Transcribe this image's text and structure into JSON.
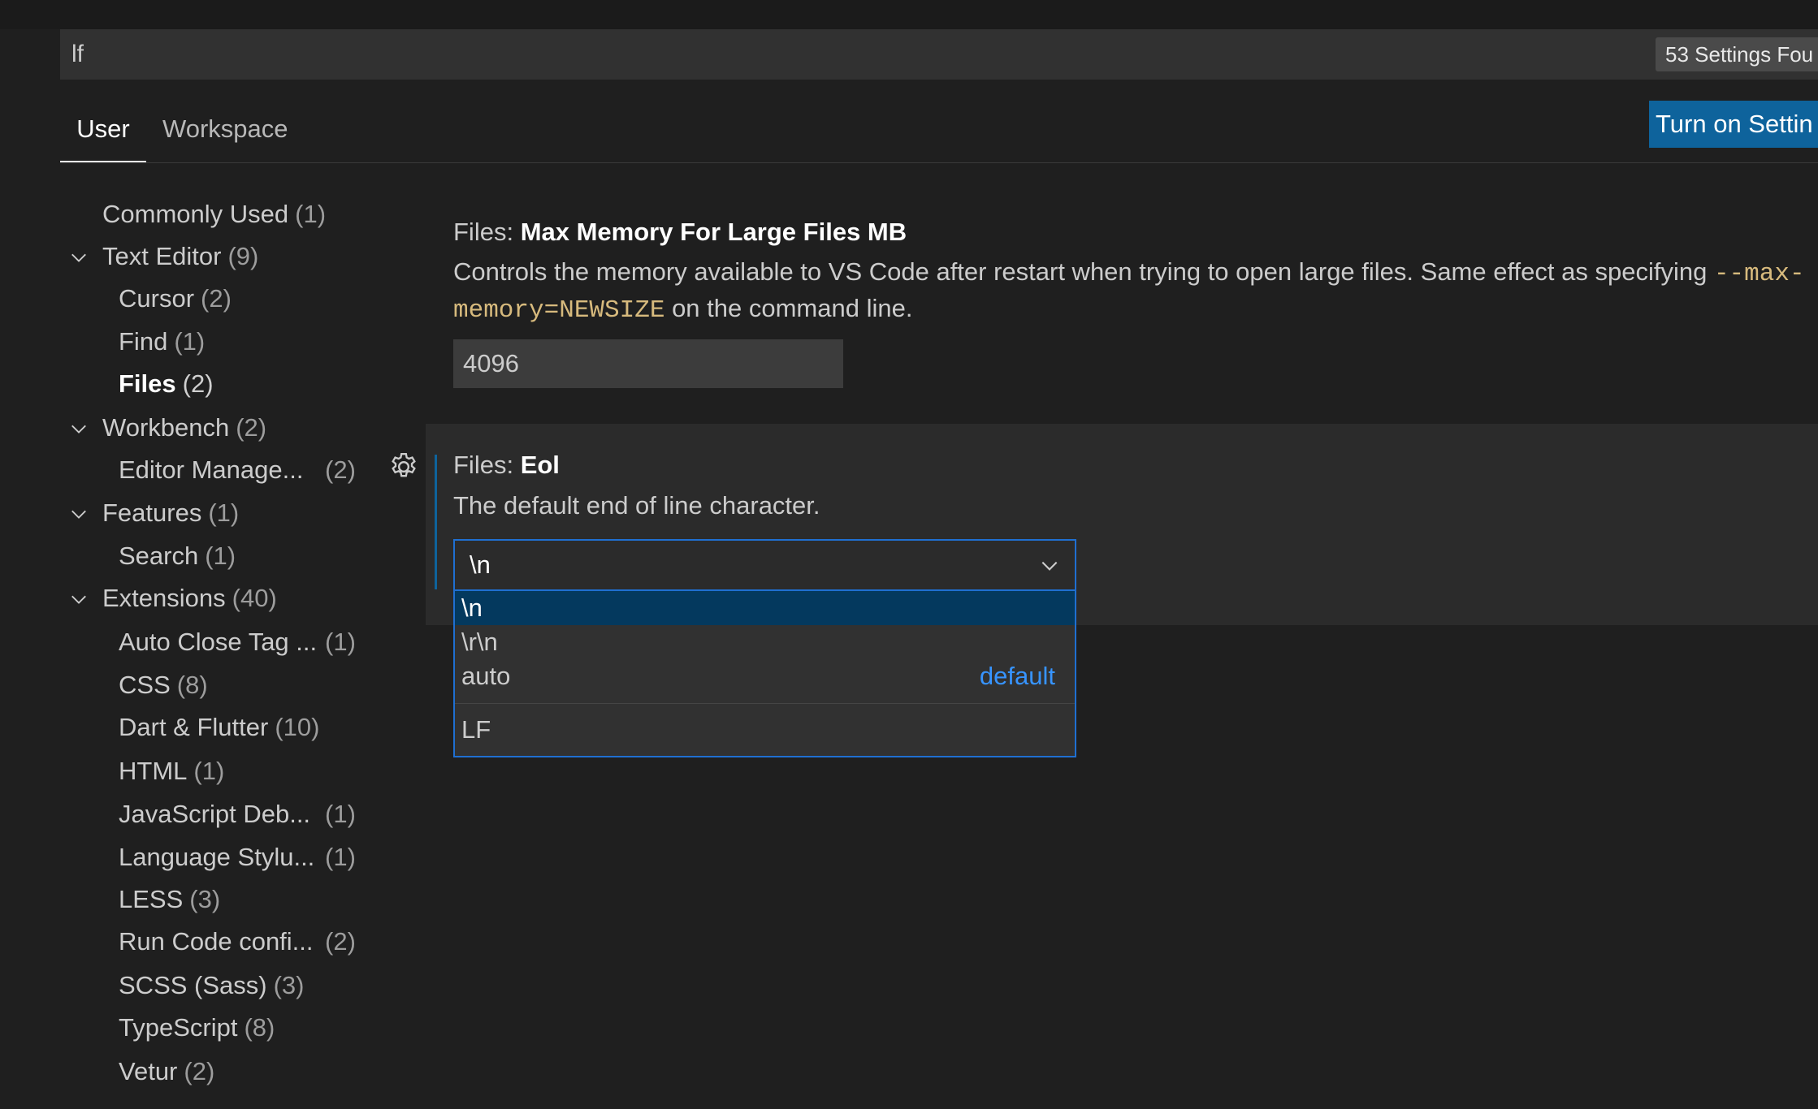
{
  "search": {
    "value": "lf",
    "result_count": "53 Settings Fou"
  },
  "tabs": [
    {
      "label": "User",
      "active": true
    },
    {
      "label": "Workspace",
      "active": false
    }
  ],
  "sync_button": {
    "label": "Turn on Settin"
  },
  "toc": {
    "items": [
      {
        "label": "Commonly Used",
        "count": "(1)",
        "level": 0,
        "expanded": null
      },
      {
        "label": "Text Editor",
        "count": "(9)",
        "level": 0,
        "expanded": true
      },
      {
        "label": "Cursor",
        "count": "(2)",
        "level": 1
      },
      {
        "label": "Find",
        "count": "(1)",
        "level": 1
      },
      {
        "label": "Files",
        "count": "(2)",
        "level": 1,
        "selected": true
      },
      {
        "label": "Workbench",
        "count": "(2)",
        "level": 0,
        "expanded": true
      },
      {
        "label": "Editor Manage...",
        "count": "(2)",
        "level": 1
      },
      {
        "label": "Features",
        "count": "(1)",
        "level": 0,
        "expanded": true
      },
      {
        "label": "Search",
        "count": "(1)",
        "level": 1
      },
      {
        "label": "Extensions",
        "count": "(40)",
        "level": 0,
        "expanded": true
      },
      {
        "label": "Auto Close Tag ...",
        "count": "(1)",
        "level": 1
      },
      {
        "label": "CSS",
        "count": "(8)",
        "level": 1
      },
      {
        "label": "Dart & Flutter",
        "count": "(10)",
        "level": 1
      },
      {
        "label": "HTML",
        "count": "(1)",
        "level": 1
      },
      {
        "label": "JavaScript Deb...",
        "count": "(1)",
        "level": 1
      },
      {
        "label": "Language Stylu...",
        "count": "(1)",
        "level": 1
      },
      {
        "label": "LESS",
        "count": "(3)",
        "level": 1
      },
      {
        "label": "Run Code confi...",
        "count": "(2)",
        "level": 1
      },
      {
        "label": "SCSS (Sass)",
        "count": "(3)",
        "level": 1
      },
      {
        "label": "TypeScript",
        "count": "(8)",
        "level": 1
      },
      {
        "label": "Vetur",
        "count": "(2)",
        "level": 1
      }
    ]
  },
  "settings": [
    {
      "category": "Files: ",
      "name": "Max Memory For Large Files MB",
      "description_pre": "Controls the memory available to VS Code after restart when trying to open large files. Same effect as specifying ",
      "description_code": "--max-memory=NEWSIZE",
      "description_post": " on the command line.",
      "value": "4096"
    },
    {
      "category": "Files: ",
      "name": "Eol",
      "description": "The default end of line character.",
      "value": "\\n",
      "options": [
        {
          "label": "\\n",
          "badge": "",
          "selected": true
        },
        {
          "label": "\\r\\n",
          "badge": "",
          "selected": false
        },
        {
          "label": "auto",
          "badge": "default",
          "selected": false
        }
      ],
      "option_description": "LF"
    }
  ],
  "colors": {
    "background": "#1f1f1f",
    "accent": "#0e639c",
    "focus_border": "#1f6fd1",
    "code": "#d7ba7d",
    "link": "#3794ff"
  }
}
